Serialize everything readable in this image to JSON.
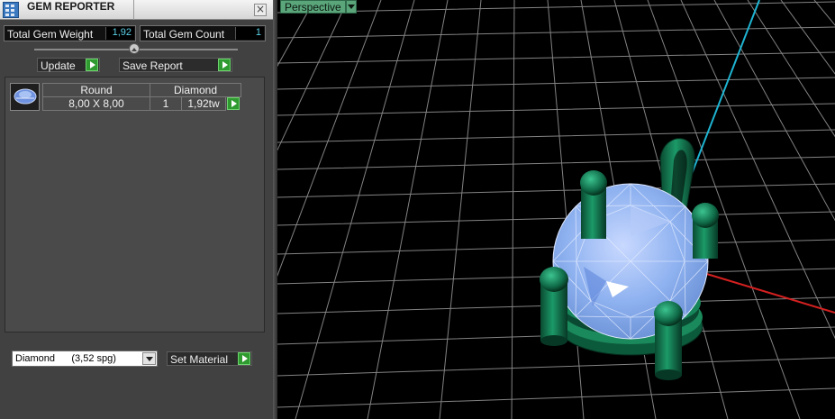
{
  "panel": {
    "title": "GEM REPORTER",
    "close_glyph": "×",
    "stats": {
      "weight_label": "Total Gem Weight",
      "weight_value": "1,92",
      "count_label": "Total Gem Count",
      "count_value": "1"
    },
    "buttons": {
      "update_label": "Update",
      "save_report_label": "Save Report"
    },
    "gem_list": [
      {
        "shape": "Round",
        "type": "Diamond",
        "size": "8,00 X 8,00",
        "quantity": "1",
        "weight": "1,92tw"
      }
    ],
    "material": {
      "selected": "Diamond      (3,52 spg)",
      "set_label": "Set Material"
    }
  },
  "viewport": {
    "view_name": "Perspective"
  },
  "icons": [
    "app-icon",
    "close-icon",
    "slider-knob",
    "play-arrow-icon",
    "gem-icon",
    "dropdown-arrow-icon"
  ],
  "colors": {
    "panel_bg": "#414141",
    "value_cyan": "#5ad0e6",
    "go_green": "#2f9a2f",
    "label_green": "#5aa57a",
    "metal_green": "#0d6b47",
    "gem_blue": "#8fb2f0",
    "axis_red": "#d42020",
    "axis_cyan": "#1eb4d2",
    "grid": "#9a9a9a"
  }
}
